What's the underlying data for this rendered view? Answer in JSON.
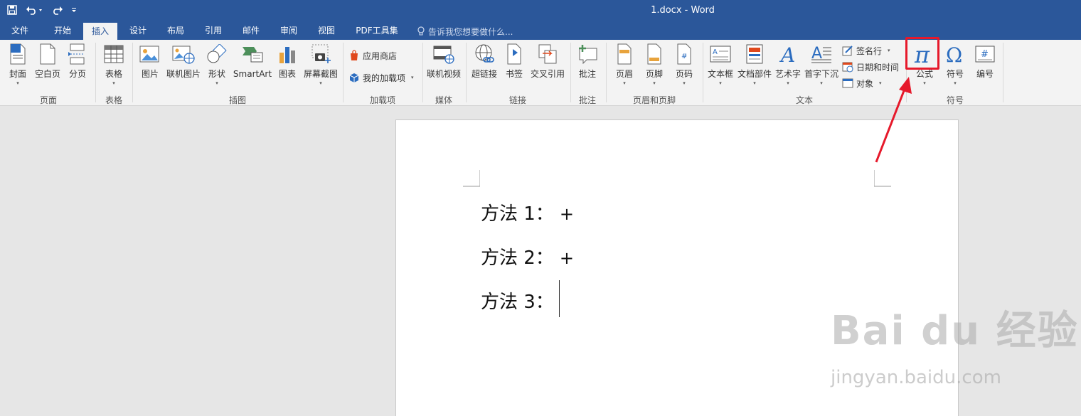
{
  "window": {
    "title": "1.docx - Word"
  },
  "tabs": [
    {
      "label": "文件"
    },
    {
      "label": "开始"
    },
    {
      "label": "插入"
    },
    {
      "label": "设计"
    },
    {
      "label": "布局"
    },
    {
      "label": "引用"
    },
    {
      "label": "邮件"
    },
    {
      "label": "审阅"
    },
    {
      "label": "视图"
    },
    {
      "label": "PDF工具集"
    }
  ],
  "active_tab": "插入",
  "tell_me": {
    "placeholder": "告诉我您想要做什么..."
  },
  "ribbon": {
    "buttons": {
      "cover": "封面",
      "blank_page": "空白页",
      "page_break": "分页",
      "table": "表格",
      "picture": "图片",
      "online_picture": "联机图片",
      "shapes": "形状",
      "smartart": "SmartArt",
      "chart": "图表",
      "screenshot": "屏幕截图",
      "app_store": "应用商店",
      "my_addins": "我的加载项",
      "online_video": "联机视频",
      "hyperlink": "超链接",
      "bookmark": "书签",
      "cross_ref": "交叉引用",
      "comment": "批注",
      "header": "页眉",
      "footer": "页脚",
      "page_number": "页码",
      "textbox": "文本框",
      "quick_parts": "文档部件",
      "wordart": "艺术字",
      "dropcap": "首字下沉",
      "signature_line": "签名行",
      "date_time": "日期和时间",
      "object": "对象",
      "equation": "公式",
      "symbol": "符号",
      "number": "编号"
    },
    "groups": {
      "pages": "页面",
      "tables": "表格",
      "illustrations": "插图",
      "addins": "加载项",
      "media": "媒体",
      "links": "链接",
      "comments": "批注",
      "header_footer": "页眉和页脚",
      "text": "文本",
      "symbols": "符号"
    }
  },
  "document": {
    "paragraphs": [
      {
        "text": "方法 1：",
        "mark": "+"
      },
      {
        "text": "方法 2：",
        "mark": "+"
      },
      {
        "text": "方法 3：",
        "mark": ""
      }
    ]
  },
  "watermark": {
    "main": "Bai du 经验",
    "sub": "jingyan.baidu.com"
  },
  "colors": {
    "titlebar": "#2b579a",
    "highlight": "#e6192b",
    "equation_icon": "#2b6cbf"
  }
}
